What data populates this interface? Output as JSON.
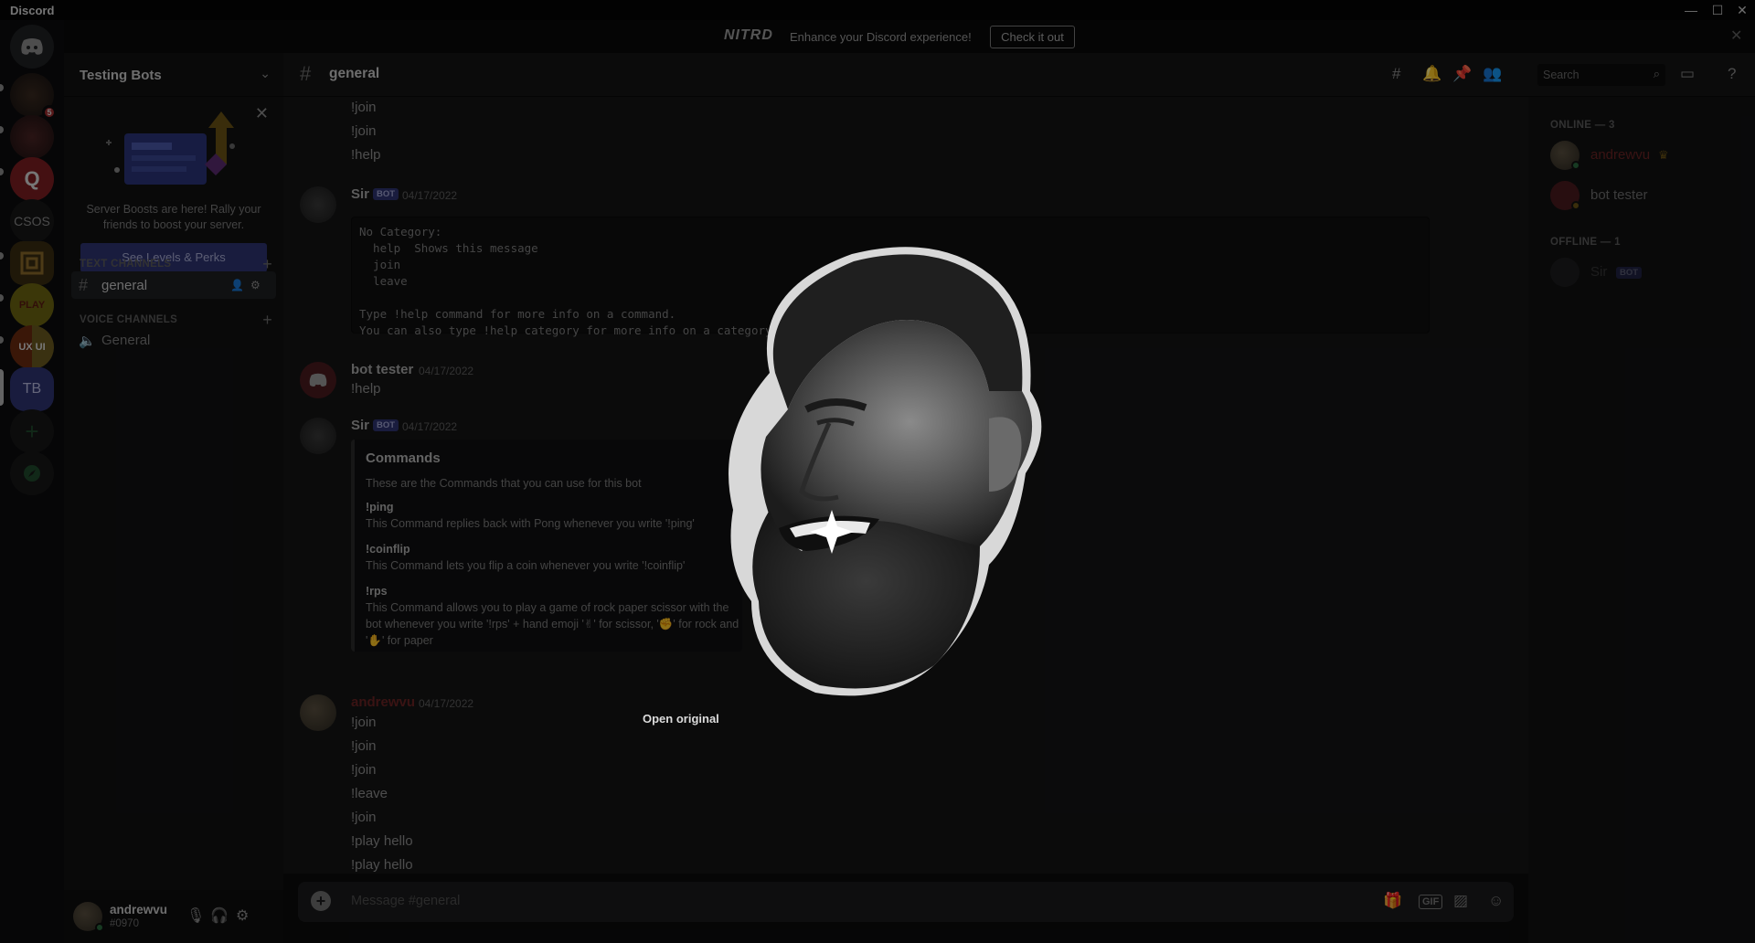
{
  "window": {
    "title": "Discord",
    "controls": [
      "—",
      "☐",
      "✕"
    ]
  },
  "nitro_banner": {
    "logo": "NITRD",
    "message": "Enhance your Discord experience!",
    "cta": "Check it out",
    "close": "✕"
  },
  "server_rail": {
    "servers": [
      {
        "name": "Direct Messages",
        "glyph": "🎮"
      },
      {
        "name": "server-1",
        "glyph": "",
        "badge": "5"
      },
      {
        "name": "server-2",
        "glyph": ""
      },
      {
        "name": "server-3",
        "glyph": "Q"
      },
      {
        "name": "CSOS",
        "glyph": "CSOS"
      },
      {
        "name": "server-5",
        "glyph": ""
      },
      {
        "name": "server-6",
        "glyph": "PLAY"
      },
      {
        "name": "server-7",
        "glyph": "UX UI"
      },
      {
        "name": "Testing Bots",
        "glyph": "TB"
      },
      {
        "name": "add-server",
        "glyph": "+"
      },
      {
        "name": "explore",
        "glyph": "⊘"
      }
    ]
  },
  "sidebar": {
    "guild_name": "Testing Bots",
    "boost": {
      "text": "Server Boosts are here! Rally your friends to boost your server.",
      "button": "See Levels & Perks"
    },
    "text_category": "TEXT CHANNELS",
    "voice_category": "VOICE CHANNELS",
    "text_channels": [
      {
        "name": "general"
      }
    ],
    "voice_channels": [
      {
        "name": "General"
      }
    ]
  },
  "user_panel": {
    "username": "andrewvu",
    "tag": "#0970"
  },
  "chat_header": {
    "channel": "general",
    "search_placeholder": "Search"
  },
  "messages": {
    "top_lines": [
      "!join",
      "!join",
      "!help"
    ],
    "msg1": {
      "author": "Sir",
      "bot": "BOT",
      "time": "04/17/2022",
      "code": "No Category:\n  help  Shows this message\n  join\n  leave\n\nType !help command for more info on a command.\nYou can also type !help category for more info on a category."
    },
    "msg2": {
      "author": "bot tester",
      "time": "04/17/2022",
      "text": "!help"
    },
    "msg3": {
      "author": "Sir",
      "bot": "BOT",
      "time": "04/17/2022",
      "embed": {
        "title": "Commands",
        "description": "These are the Commands that you can use for this bot",
        "fields": [
          {
            "name": "!ping",
            "value": "This Command replies back with Pong whenever you write '!ping'"
          },
          {
            "name": "!coinflip",
            "value": "This Command lets you flip a coin whenever you write '!coinflip'"
          },
          {
            "name": "!rps",
            "value": "This Command allows you to play a game of rock paper scissor with the bot whenever you write '!rps' + hand emoji '✌' for scissor, '✊' for rock and '✋' for paper"
          }
        ]
      }
    },
    "msg4": {
      "author": "andrewvu",
      "time": "04/17/2022",
      "lines": [
        "!join",
        "!join",
        "!join",
        "!leave",
        "!join",
        "!play hello",
        "!play hello"
      ]
    }
  },
  "composer": {
    "placeholder": "Message #general"
  },
  "members": {
    "online_header": "ONLINE — 3",
    "offline_header": "OFFLINE — 1",
    "online": [
      {
        "name": "andrewvu",
        "color": "#7a2a2a"
      },
      {
        "name": "bot tester",
        "color": "#7a7a7a"
      }
    ],
    "offline": [
      {
        "name": "Sir",
        "bot": "BOT"
      }
    ]
  },
  "viewer": {
    "open_original": "Open original"
  },
  "colors": {
    "accent": "#2f3472",
    "background": "#141415"
  }
}
